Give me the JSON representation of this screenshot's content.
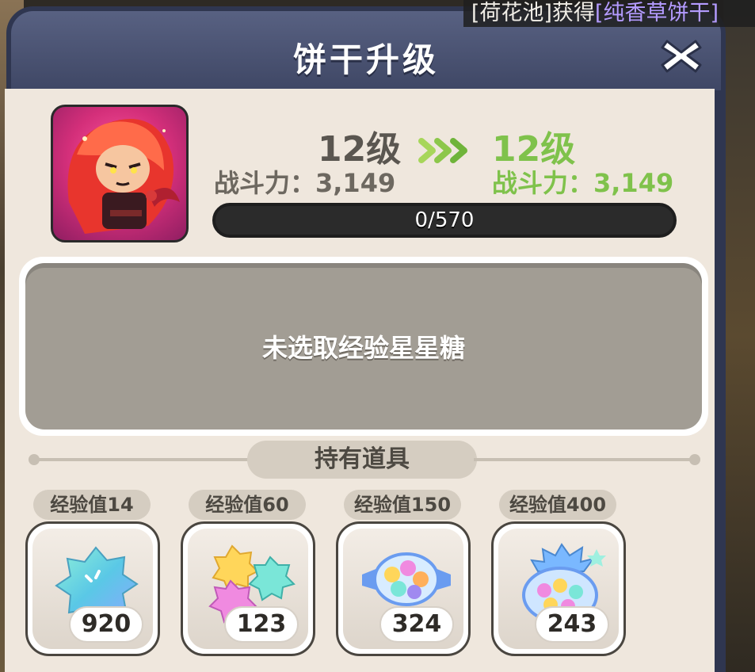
{
  "notification": {
    "prefix": "[荷花池]获得",
    "item": "[纯香草饼干]"
  },
  "dialog": {
    "title": "饼干升级",
    "close_icon": "close-x-icon"
  },
  "cookie": {
    "portrait_icon": "red-haired-cookie-portrait",
    "current_level": "12级",
    "next_level": "12级",
    "current_power": "战斗力：3,149",
    "next_power": "战斗力：3,149",
    "arrow_icon": "triple-chevron-right-icon",
    "exp_progress": "0/570",
    "exp_current": 0,
    "exp_max": 570
  },
  "selection": {
    "empty_text": "未选取经验星星糖"
  },
  "inventory": {
    "title": "持有道具",
    "items": [
      {
        "label": "经验值14",
        "count": "920",
        "icon": "cyan-star-candy-icon"
      },
      {
        "label": "经验值60",
        "count": "123",
        "icon": "multi-star-candy-icon"
      },
      {
        "label": "经验值150",
        "count": "324",
        "icon": "wrapped-candy-icon"
      },
      {
        "label": "经验值400",
        "count": "243",
        "icon": "candy-bag-icon"
      }
    ]
  },
  "colors": {
    "header": "#4a5272",
    "panel": "#efe7dd",
    "next_level_green": "#7fc24b"
  }
}
